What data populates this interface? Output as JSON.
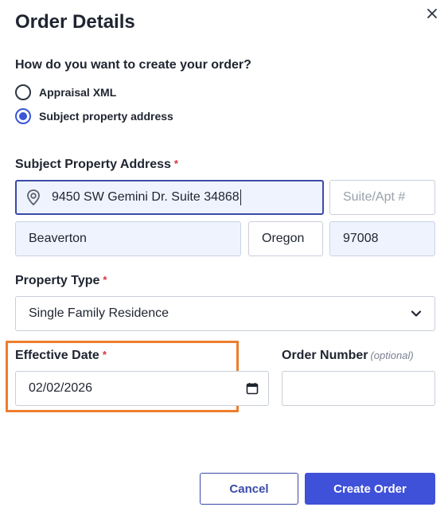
{
  "dialog": {
    "title": "Order Details"
  },
  "create_method": {
    "question": "How do you want to create your order?",
    "options": [
      {
        "label": "Appraisal XML",
        "selected": false
      },
      {
        "label": "Subject property address",
        "selected": true
      }
    ]
  },
  "address": {
    "label": "Subject Property Address",
    "required_mark": "*",
    "street": "9450 SW Gemini Dr. Suite 34868",
    "suite_placeholder": "Suite/Apt #",
    "city": "Beaverton",
    "state": "Oregon",
    "zip": "97008"
  },
  "property_type": {
    "label": "Property Type",
    "required_mark": "*",
    "selected": "Single Family Residence"
  },
  "effective_date": {
    "label": "Effective Date",
    "required_mark": "*",
    "value": "02/02/2026"
  },
  "order_number": {
    "label": "Order Number",
    "optional": "(optional)",
    "value": ""
  },
  "footer": {
    "cancel_label": "Cancel",
    "submit_label": "Create Order"
  },
  "colors": {
    "accent": "#3f51d8",
    "highlight": "#ee7d2c",
    "required": "#d9323a"
  },
  "icons": {
    "close": "close-icon",
    "location": "location-pin-icon",
    "dropdown": "chevron-down-icon",
    "calendar": "calendar-icon"
  }
}
